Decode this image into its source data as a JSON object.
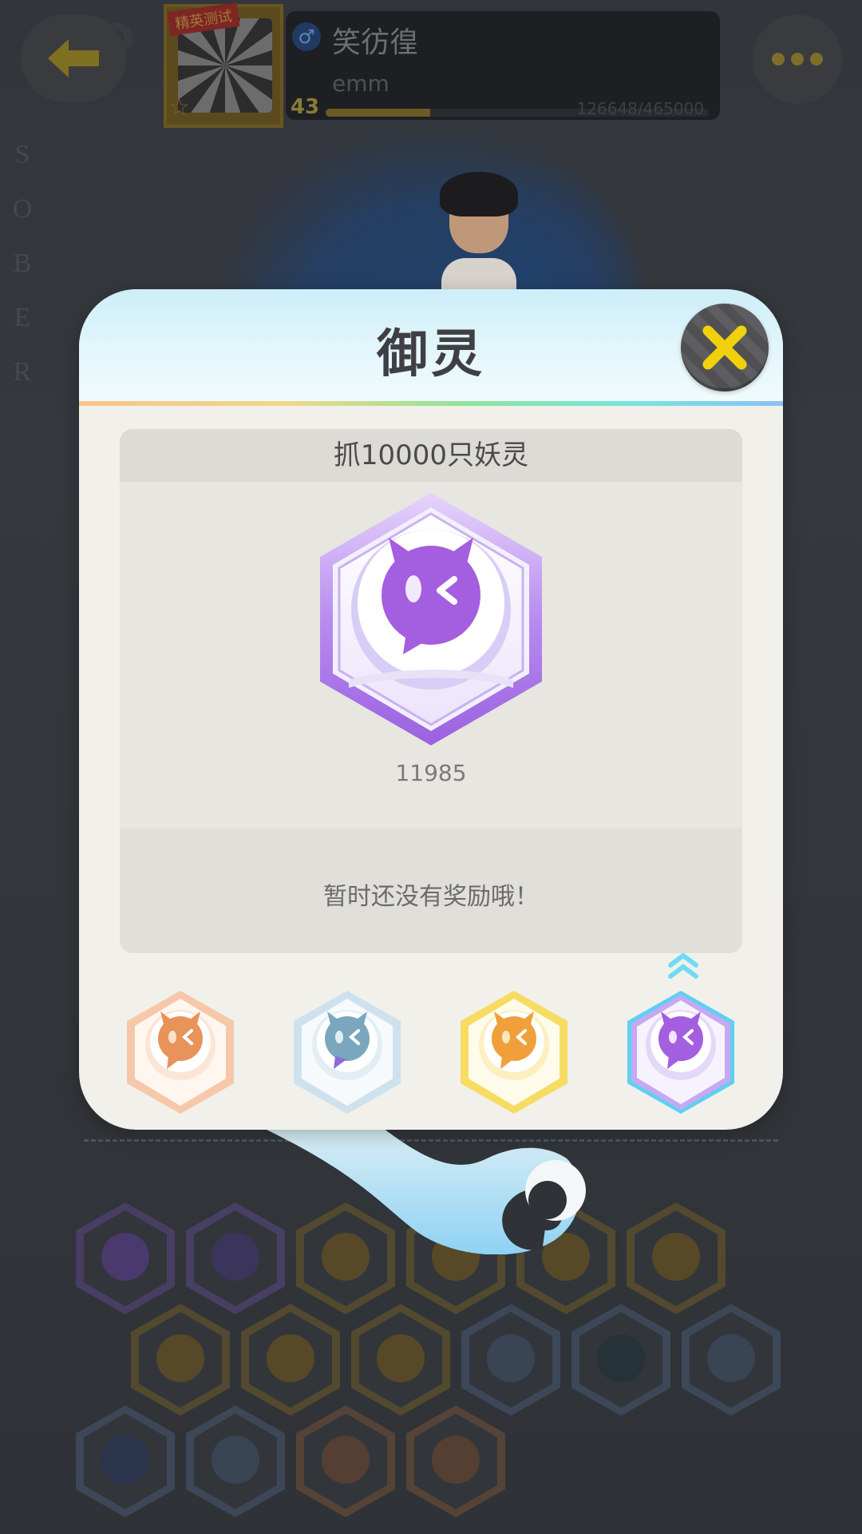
{
  "background": {
    "vertical_text": [
      "S",
      "O",
      "B",
      "E",
      "R"
    ]
  },
  "header": {
    "profile_tag": "精英测试",
    "player_name": "笑彷徨",
    "signature": "emm",
    "level": "43",
    "exp_text": "126648/465000",
    "exp_progress": 0.272
  },
  "popup": {
    "title": "御灵",
    "achievement": {
      "title": "抓10000只妖灵",
      "count": "11985",
      "current_tier": "purple"
    },
    "reward_text": "暂时还没有奖励哦！",
    "tiers": [
      {
        "name": "bronze",
        "color": "#e8935a",
        "frame": "#f6c8a9",
        "selected": false
      },
      {
        "name": "silver",
        "color": "#7aa7bd",
        "frame": "#cfe1ec",
        "selected": false
      },
      {
        "name": "gold",
        "color": "#f0a03a",
        "frame": "#f7dc62",
        "selected": false
      },
      {
        "name": "purple",
        "color": "#a45ee0",
        "frame": "#c7a8f2",
        "selected": true
      }
    ]
  },
  "colors": {
    "accent_yellow": "#f2d10c",
    "purple": "#a45ee0",
    "popup_bg": "#f1f0ea"
  },
  "icons": {
    "back": "back-arrow-icon",
    "more": "more-dots-icon",
    "close": "close-x-icon",
    "gender": "male-icon",
    "level_up": "level-up-chevron-icon"
  }
}
